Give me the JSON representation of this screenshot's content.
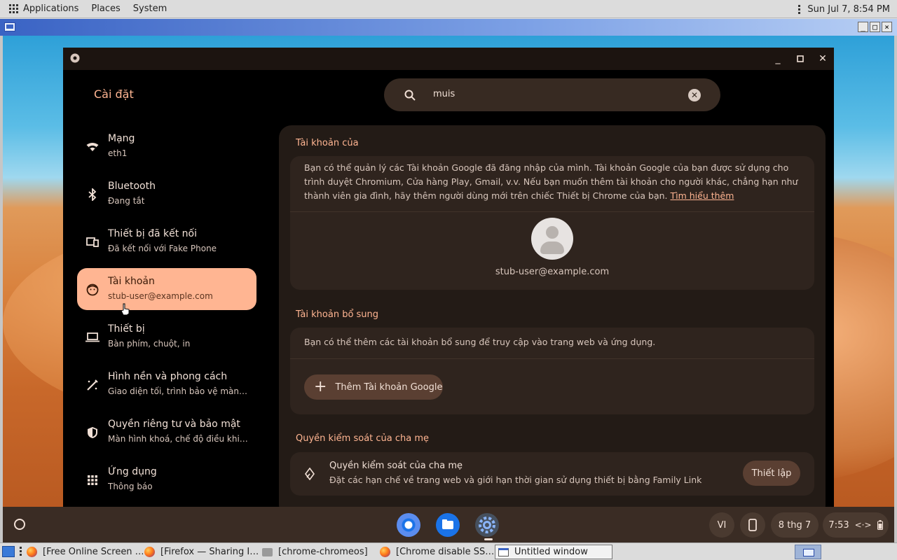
{
  "host_panel": {
    "menus": [
      "Applications",
      "Places",
      "System"
    ],
    "clock": "Sun Jul  7,  8:54 PM"
  },
  "settings": {
    "app_title": "Cài đặt",
    "search": {
      "value": "muis",
      "placeholder": ""
    },
    "nav": [
      {
        "label": "Mạng",
        "sub": "eth1",
        "icon": "wifi-icon"
      },
      {
        "label": "Bluetooth",
        "sub": "Đang tắt",
        "icon": "bluetooth-icon"
      },
      {
        "label": "Thiết bị đã kết nối",
        "sub": "Đã kết nối với Fake Phone",
        "icon": "connected-devices-icon"
      },
      {
        "label": "Tài khoản",
        "sub": "stub-user@example.com",
        "icon": "account-icon",
        "active": true
      },
      {
        "label": "Thiết bị",
        "sub": "Bàn phím, chuột, in",
        "icon": "laptop-icon"
      },
      {
        "label": "Hình nền và phong cách",
        "sub": "Giao diện tối, trình bảo vệ màn …",
        "icon": "paintbrush-icon"
      },
      {
        "label": "Quyền riêng tư và bảo mật",
        "sub": "Màn hình khoá, chế độ điều khiển",
        "icon": "shield-icon"
      },
      {
        "label": "Ứng dụng",
        "sub": "Thông báo",
        "icon": "apps-grid-icon"
      }
    ],
    "accounts_section": {
      "title": "Tài khoản của",
      "description": "Bạn có thể quản lý các Tài khoản Google đã đăng nhập của mình. Tài khoản Google của bạn được sử dụng cho trình duyệt Chromium, Cửa hàng Play, Gmail, v.v. Nếu bạn muốn thêm tài khoản cho người khác, chẳng hạn như thành viên gia đình, hãy thêm người dùng mới trên chiếc Thiết bị Chrome của bạn.",
      "learn_more": "Tìm hiểu thêm",
      "email": "stub-user@example.com"
    },
    "additional_section": {
      "title": "Tài khoản bổ sung",
      "description": "Bạn có thể thêm các tài khoản bổ sung để truy cập vào trang web và ứng dụng.",
      "add_button": "Thêm Tài khoản Google"
    },
    "parental_section": {
      "title": "Quyền kiểm soát của cha mẹ",
      "row_title": "Quyền kiểm soát của cha mẹ",
      "row_sub": "Đặt các hạn chế về trang web và giới hạn thời gian sử dụng thiết bị bằng Family Link",
      "setup_button": "Thiết lập"
    }
  },
  "shelf": {
    "ime": "VI",
    "date": "8 thg 7",
    "time": "7:53"
  },
  "taskbar": {
    "items": [
      {
        "label": "[Free Online Screen …",
        "icon": "firefox-icon"
      },
      {
        "label": "[Firefox — Sharing I…",
        "icon": "firefox-icon"
      },
      {
        "label": "[chrome-chromeos]",
        "icon": "folder-icon"
      },
      {
        "label": "[Chrome disable SS…",
        "icon": "firefox-icon"
      },
      {
        "label": "Untitled window",
        "icon": "window-icon",
        "active": true
      }
    ]
  },
  "colors": {
    "accent": "#ffb592",
    "surface": "#231b16",
    "card": "#2f241e",
    "text": "#f1e0d6"
  }
}
